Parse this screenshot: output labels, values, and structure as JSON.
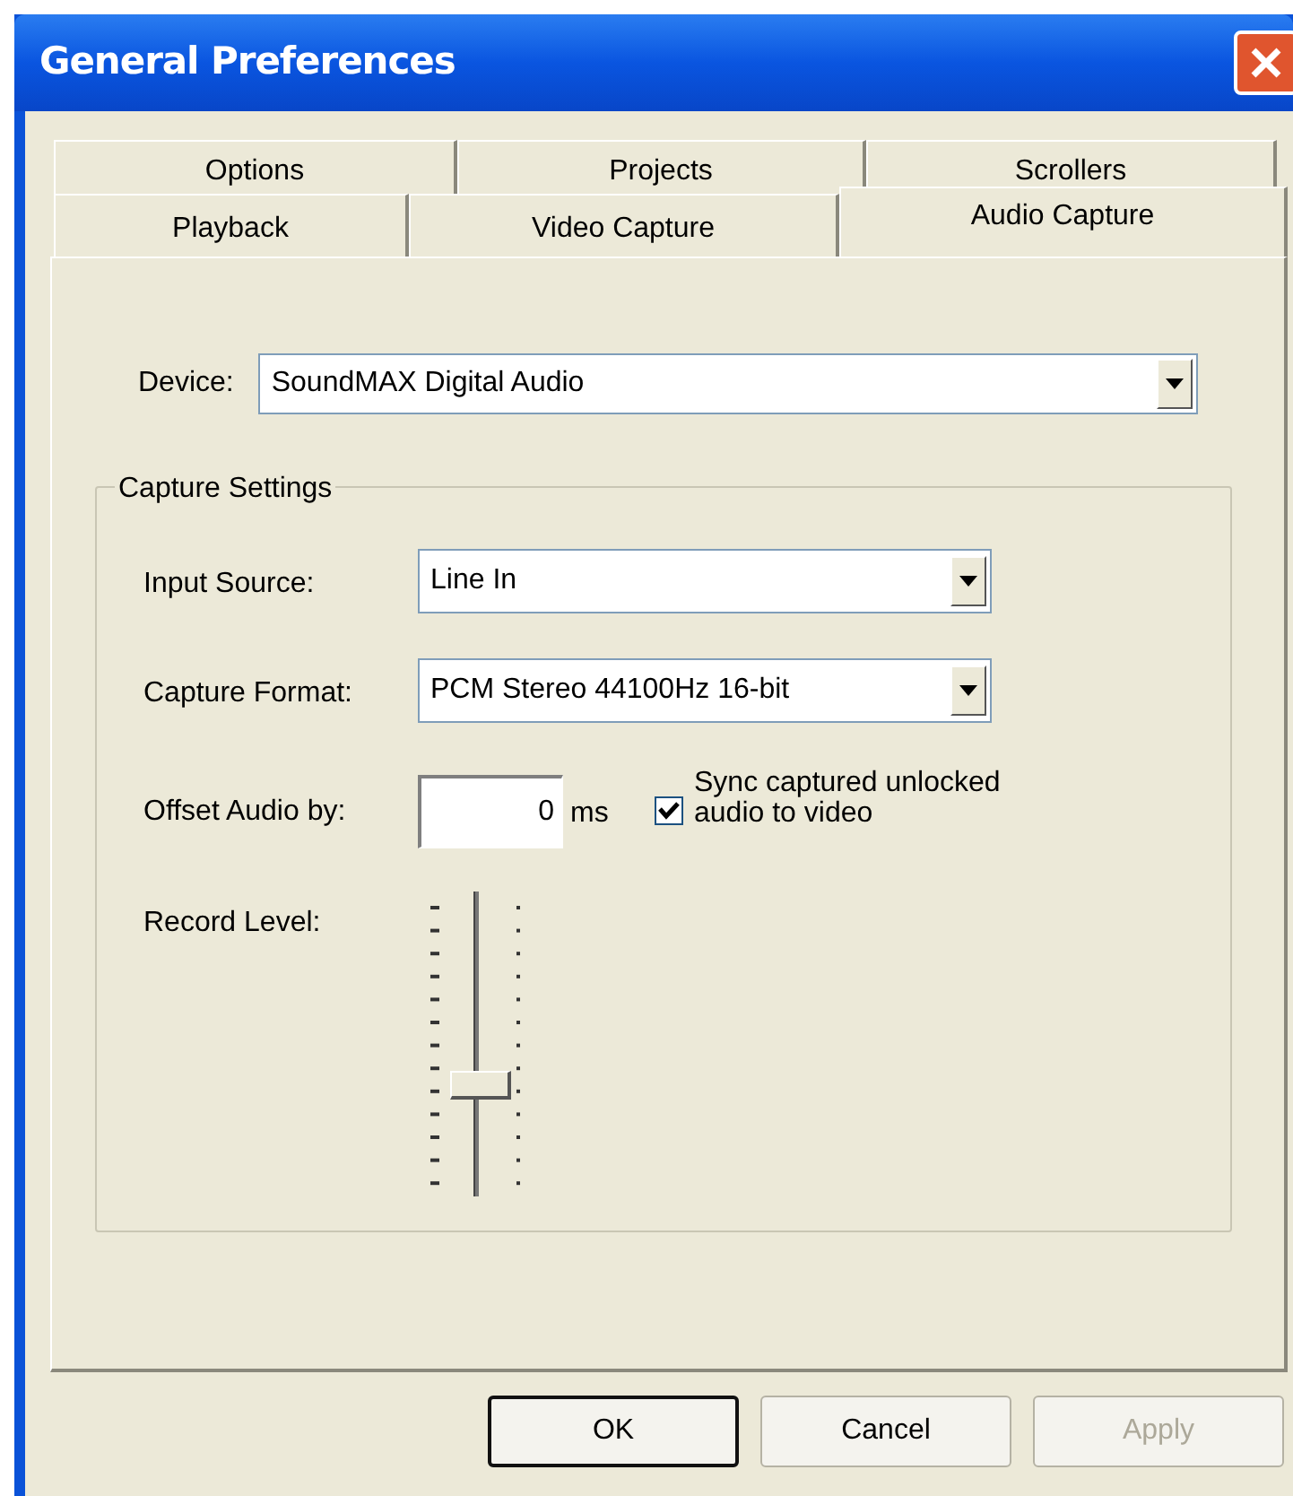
{
  "window": {
    "title": "General Preferences"
  },
  "tab_rows": [
    {
      "tabs": [
        {
          "label": "Options",
          "selected": false
        },
        {
          "label": "Projects",
          "selected": false
        },
        {
          "label": "Scrollers",
          "selected": false
        }
      ]
    },
    {
      "tabs": [
        {
          "label": "Playback",
          "selected": false
        },
        {
          "label": "Video Capture",
          "selected": false
        },
        {
          "label": "Audio Capture",
          "selected": true
        }
      ]
    }
  ],
  "device": {
    "label": "Device:",
    "value": "SoundMAX Digital Audio"
  },
  "capture_settings": {
    "title": "Capture Settings",
    "input_source": {
      "label": "Input Source:",
      "value": "Line In"
    },
    "capture_format": {
      "label": "Capture Format:",
      "value": "PCM Stereo 44100Hz 16-bit"
    },
    "offset": {
      "label": "Offset Audio by:",
      "value": "0",
      "unit": "ms"
    },
    "sync": {
      "label": "Sync captured unlocked audio to video",
      "checked": true
    },
    "record_level": {
      "label": "Record Level:",
      "level": 0.35
    }
  },
  "buttons": [
    {
      "label": "OK",
      "default": true,
      "disabled": false
    },
    {
      "label": "Cancel",
      "default": false,
      "disabled": false
    },
    {
      "label": "Apply",
      "default": false,
      "disabled": true
    }
  ]
}
